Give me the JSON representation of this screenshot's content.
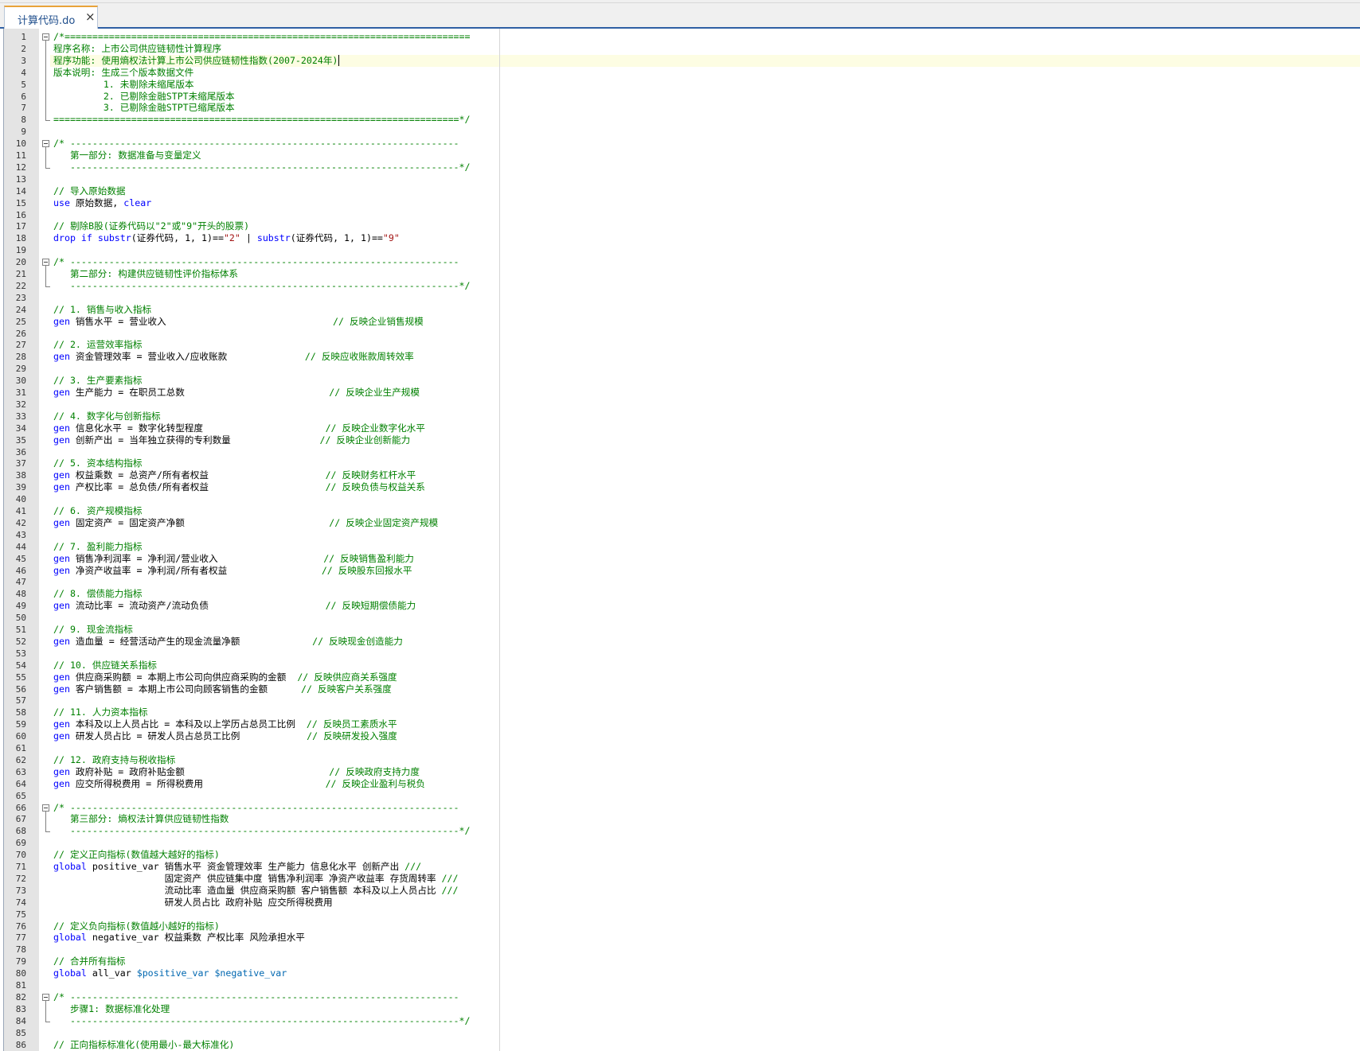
{
  "tab": {
    "title": "计算代码.do",
    "close": "×"
  },
  "lines": [
    [
      {
        "t": "/*=========================================================================",
        "c": "cm"
      }
    ],
    [
      {
        "t": "程序名称: 上市公司供应链韧性计算程序",
        "c": "cm"
      }
    ],
    [
      {
        "t": "程序功能: 使用熵权法计算上市公司供应链韧性指数(2007-2024年)",
        "c": "cm"
      }
    ],
    [
      {
        "t": "版本说明: 生成三个版本数据文件",
        "c": "cm"
      }
    ],
    [
      {
        "t": "         1. 未剔除未缩尾版本",
        "c": "cm"
      }
    ],
    [
      {
        "t": "         2. 已剔除金融STPT未缩尾版本",
        "c": "cm"
      }
    ],
    [
      {
        "t": "         3. 已剔除金融STPT已缩尾版本",
        "c": "cm"
      }
    ],
    [
      {
        "t": "=========================================================================*/",
        "c": "cm"
      }
    ],
    [],
    [
      {
        "t": "/* ----------------------------------------------------------------------",
        "c": "cm"
      }
    ],
    [
      {
        "t": "   第一部分: 数据准备与变量定义",
        "c": "cm"
      }
    ],
    [
      {
        "t": "   ----------------------------------------------------------------------*/",
        "c": "cm"
      }
    ],
    [],
    [
      {
        "t": "// 导入原始数据",
        "c": "cm"
      }
    ],
    [
      {
        "t": "use",
        "c": "kw"
      },
      {
        "t": " 原始数据, "
      },
      {
        "t": "clear",
        "c": "kw"
      }
    ],
    [],
    [
      {
        "t": "// 剔除B股(证券代码以\"2\"或\"9\"开头的股票)",
        "c": "cm"
      }
    ],
    [
      {
        "t": "drop if",
        "c": "kw"
      },
      {
        "t": " "
      },
      {
        "t": "substr",
        "c": "kw"
      },
      {
        "t": "(证券代码, 1, 1)=="
      },
      {
        "t": "\"2\"",
        "c": "st"
      },
      {
        "t": " | "
      },
      {
        "t": "substr",
        "c": "kw"
      },
      {
        "t": "(证券代码, 1, 1)=="
      },
      {
        "t": "\"9\"",
        "c": "st"
      }
    ],
    [],
    [
      {
        "t": "/* ----------------------------------------------------------------------",
        "c": "cm"
      }
    ],
    [
      {
        "t": "   第二部分: 构建供应链韧性评价指标体系",
        "c": "cm"
      }
    ],
    [
      {
        "t": "   ----------------------------------------------------------------------*/",
        "c": "cm"
      }
    ],
    [],
    [
      {
        "t": "// 1. 销售与收入指标",
        "c": "cm"
      }
    ],
    [
      {
        "t": "gen",
        "c": "kw"
      },
      {
        "t": " 销售水平 = 营业收入                              "
      },
      {
        "t": "// 反映企业销售规模",
        "c": "cm"
      }
    ],
    [],
    [
      {
        "t": "// 2. 运营效率指标",
        "c": "cm"
      }
    ],
    [
      {
        "t": "gen",
        "c": "kw"
      },
      {
        "t": " 资金管理效率 = 营业收入/应收账款              "
      },
      {
        "t": "// 反映应收账款周转效率",
        "c": "cm"
      }
    ],
    [],
    [
      {
        "t": "// 3. 生产要素指标",
        "c": "cm"
      }
    ],
    [
      {
        "t": "gen",
        "c": "kw"
      },
      {
        "t": " 生产能力 = 在职员工总数                          "
      },
      {
        "t": "// 反映企业生产规模",
        "c": "cm"
      }
    ],
    [],
    [
      {
        "t": "// 4. 数字化与创新指标",
        "c": "cm"
      }
    ],
    [
      {
        "t": "gen",
        "c": "kw"
      },
      {
        "t": " 信息化水平 = 数字化转型程度                      "
      },
      {
        "t": "// 反映企业数字化水平",
        "c": "cm"
      }
    ],
    [
      {
        "t": "gen",
        "c": "kw"
      },
      {
        "t": " 创新产出 = 当年独立获得的专利数量                "
      },
      {
        "t": "// 反映企业创新能力",
        "c": "cm"
      }
    ],
    [],
    [
      {
        "t": "// 5. 资本结构指标",
        "c": "cm"
      }
    ],
    [
      {
        "t": "gen",
        "c": "kw"
      },
      {
        "t": " 权益乘数 = 总资产/所有者权益                     "
      },
      {
        "t": "// 反映财务杠杆水平",
        "c": "cm"
      }
    ],
    [
      {
        "t": "gen",
        "c": "kw"
      },
      {
        "t": " 产权比率 = 总负债/所有者权益                     "
      },
      {
        "t": "// 反映负债与权益关系",
        "c": "cm"
      }
    ],
    [],
    [
      {
        "t": "// 6. 资产规模指标",
        "c": "cm"
      }
    ],
    [
      {
        "t": "gen",
        "c": "kw"
      },
      {
        "t": " 固定资产 = 固定资产净额                          "
      },
      {
        "t": "// 反映企业固定资产规模",
        "c": "cm"
      }
    ],
    [],
    [
      {
        "t": "// 7. 盈利能力指标",
        "c": "cm"
      }
    ],
    [
      {
        "t": "gen",
        "c": "kw"
      },
      {
        "t": " 销售净利润率 = 净利润/营业收入                   "
      },
      {
        "t": "// 反映销售盈利能力",
        "c": "cm"
      }
    ],
    [
      {
        "t": "gen",
        "c": "kw"
      },
      {
        "t": " 净资产收益率 = 净利润/所有者权益                 "
      },
      {
        "t": "// 反映股东回报水平",
        "c": "cm"
      }
    ],
    [],
    [
      {
        "t": "// 8. 偿债能力指标",
        "c": "cm"
      }
    ],
    [
      {
        "t": "gen",
        "c": "kw"
      },
      {
        "t": " 流动比率 = 流动资产/流动负债                     "
      },
      {
        "t": "// 反映短期偿债能力",
        "c": "cm"
      }
    ],
    [],
    [
      {
        "t": "// 9. 现金流指标",
        "c": "cm"
      }
    ],
    [
      {
        "t": "gen",
        "c": "kw"
      },
      {
        "t": " 造血量 = 经营活动产生的现金流量净额             "
      },
      {
        "t": "// 反映现金创造能力",
        "c": "cm"
      }
    ],
    [],
    [
      {
        "t": "// 10. 供应链关系指标",
        "c": "cm"
      }
    ],
    [
      {
        "t": "gen",
        "c": "kw"
      },
      {
        "t": " 供应商采购额 = 本期上市公司向供应商采购的金额  "
      },
      {
        "t": "// 反映供应商关系强度",
        "c": "cm"
      }
    ],
    [
      {
        "t": "gen",
        "c": "kw"
      },
      {
        "t": " 客户销售额 = 本期上市公司向顾客销售的金额      "
      },
      {
        "t": "// 反映客户关系强度",
        "c": "cm"
      }
    ],
    [],
    [
      {
        "t": "// 11. 人力资本指标",
        "c": "cm"
      }
    ],
    [
      {
        "t": "gen",
        "c": "kw"
      },
      {
        "t": " 本科及以上人员占比 = 本科及以上学历占总员工比例  "
      },
      {
        "t": "// 反映员工素质水平",
        "c": "cm"
      }
    ],
    [
      {
        "t": "gen",
        "c": "kw"
      },
      {
        "t": " 研发人员占比 = 研发人员占总员工比例            "
      },
      {
        "t": "// 反映研发投入强度",
        "c": "cm"
      }
    ],
    [],
    [
      {
        "t": "// 12. 政府支持与税收指标",
        "c": "cm"
      }
    ],
    [
      {
        "t": "gen",
        "c": "kw"
      },
      {
        "t": " 政府补贴 = 政府补贴金额                          "
      },
      {
        "t": "// 反映政府支持力度",
        "c": "cm"
      }
    ],
    [
      {
        "t": "gen",
        "c": "kw"
      },
      {
        "t": " 应交所得税费用 = 所得税费用                      "
      },
      {
        "t": "// 反映企业盈利与税负",
        "c": "cm"
      }
    ],
    [],
    [
      {
        "t": "/* ----------------------------------------------------------------------",
        "c": "cm"
      }
    ],
    [
      {
        "t": "   第三部分: 熵权法计算供应链韧性指数",
        "c": "cm"
      }
    ],
    [
      {
        "t": "   ----------------------------------------------------------------------*/",
        "c": "cm"
      }
    ],
    [],
    [
      {
        "t": "// 定义正向指标(数值越大越好的指标)",
        "c": "cm"
      }
    ],
    [
      {
        "t": "global",
        "c": "kw"
      },
      {
        "t": " positive_var 销售水平 资金管理效率 生产能力 信息化水平 创新产出 "
      },
      {
        "t": "///",
        "c": "cm"
      }
    ],
    [
      {
        "t": "                    固定资产 供应链集中度 销售净利润率 净资产收益率 存货周转率 "
      },
      {
        "t": "///",
        "c": "cm"
      }
    ],
    [
      {
        "t": "                    流动比率 造血量 供应商采购额 客户销售额 本科及以上人员占比 "
      },
      {
        "t": "///",
        "c": "cm"
      }
    ],
    [
      {
        "t": "                    研发人员占比 政府补贴 应交所得税费用"
      }
    ],
    [],
    [
      {
        "t": "// 定义负向指标(数值越小越好的指标)",
        "c": "cm"
      }
    ],
    [
      {
        "t": "global",
        "c": "kw"
      },
      {
        "t": " negative_var 权益乘数 产权比率 风险承担水平"
      }
    ],
    [],
    [
      {
        "t": "// 合并所有指标",
        "c": "cm"
      }
    ],
    [
      {
        "t": "global",
        "c": "kw"
      },
      {
        "t": " all_var "
      },
      {
        "t": "$positive_var $negative_var",
        "c": "ma"
      }
    ],
    [],
    [
      {
        "t": "/* ----------------------------------------------------------------------",
        "c": "cm"
      }
    ],
    [
      {
        "t": "   步骤1: 数据标准化处理",
        "c": "cm"
      }
    ],
    [
      {
        "t": "   ----------------------------------------------------------------------*/",
        "c": "cm"
      }
    ],
    [],
    [
      {
        "t": "// 正向指标标准化(使用最小-最大标准化)",
        "c": "cm"
      }
    ]
  ]
}
